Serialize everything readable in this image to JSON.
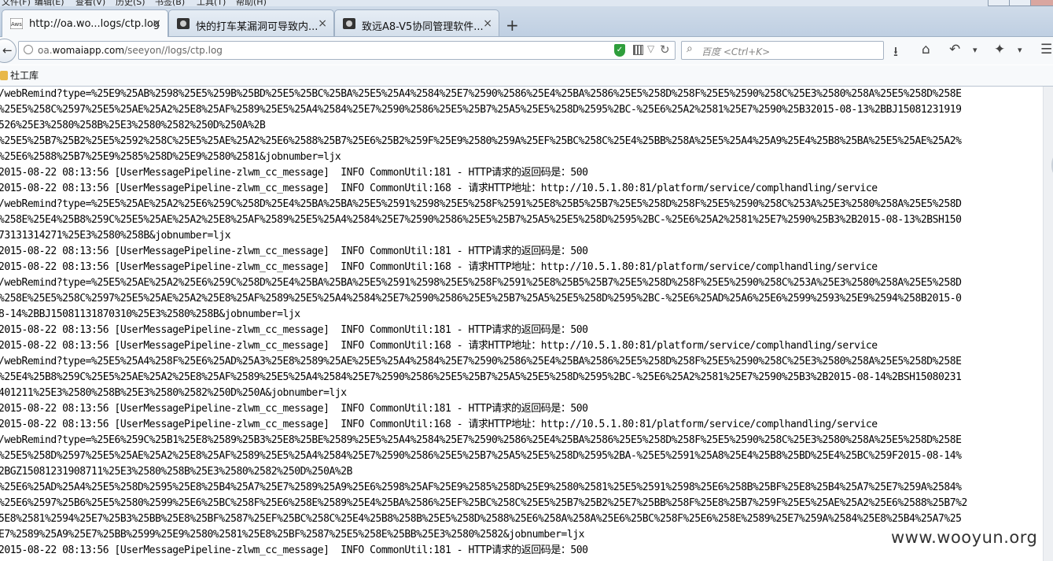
{
  "menu": [
    "文件(F)",
    "编辑(E)",
    "查看(V)",
    "历史(S)",
    "书签(B)",
    "工具(T)",
    "帮助(H)"
  ],
  "tabs": [
    {
      "title": "http://oa.wo...logs/ctp.log",
      "active": true
    },
    {
      "title": "快的打车某漏洞可导致内...",
      "active": false
    },
    {
      "title": "致远A8-V5协同管理软件...",
      "active": false
    }
  ],
  "newtab": "+",
  "close_glyph": "×",
  "urlbar": {
    "prefix": "oa.",
    "domain": "womaiapp.com",
    "path": "/seeyon//logs/ctp.log"
  },
  "search": {
    "placeholder": "百度 <Ctrl+K>"
  },
  "bookmarks": [
    {
      "label": "社工库"
    }
  ],
  "log_lines": [
    "/webRemind?type=%25E9%25AB%2598%25E5%259B%25BD%25E5%25BC%25BA%25E5%25A4%2584%25E7%2590%2586%25E4%25BA%2586%25E5%258D%258F%25E5%2590%258C%25E3%2580%258A%25E5%258D%258E",
    "%25E5%258C%2597%25E5%25AE%25A2%25E8%25AF%2589%25E5%25A4%2584%25E7%2590%2586%25E5%25B7%25A5%25E5%258D%2595%2BC-%25E6%25A2%2581%25E7%2590%25B32015-08-13%2BBJ15081231919",
    "526%25E3%2580%258B%25E3%2580%2582%250D%250A%2B",
    "%25E5%25B7%25B2%25E5%2592%258C%25E5%25AE%25A2%25E6%2588%25B7%25E6%25B2%259F%25E9%2580%259A%25EF%25BC%258C%25E4%25BB%258A%25E5%25A4%25A9%25E4%25B8%25BA%25E5%25AE%25A2%",
    "%25E6%2588%25B7%25E9%2585%258D%25E9%2580%2581&jobnumber=ljx",
    "2015-08-22 08:13:56 [UserMessagePipeline-zlwm_cc_message]  INFO CommonUtil:181 - HTTP请求的返回码是：500",
    "2015-08-22 08:13:56 [UserMessagePipeline-zlwm_cc_message]  INFO CommonUtil:168 - 请求HTTP地址：http://10.5.1.80:81/platform/service/complhandling/service",
    "/webRemind?type=%25E5%25AE%25A2%25E6%259C%258D%25E4%25BA%25BA%25E5%2591%2598%25E5%258F%2591%25E8%25B5%25B7%25E5%258D%258F%25E5%2590%258C%253A%25E3%2580%258A%25E5%258D",
    "%258E%25E4%25B8%259C%25E5%25AE%25A2%25E8%25AF%2589%25E5%25A4%2584%25E7%2590%2586%25E5%25B7%25A5%25E5%258D%2595%2BC-%25E6%25A2%2581%25E7%2590%25B3%2B2015-08-13%2BSH150",
    "73131314271%25E3%2580%258B&jobnumber=ljx",
    "2015-08-22 08:13:56 [UserMessagePipeline-zlwm_cc_message]  INFO CommonUtil:181 - HTTP请求的返回码是：500",
    "2015-08-22 08:13:56 [UserMessagePipeline-zlwm_cc_message]  INFO CommonUtil:168 - 请求HTTP地址：http://10.5.1.80:81/platform/service/complhandling/service",
    "/webRemind?type=%25E5%25AE%25A2%25E6%259C%258D%25E4%25BA%25BA%25E5%2591%2598%25E5%258F%2591%25E8%25B5%25B7%25E5%258D%258F%25E5%2590%258C%253A%25E3%2580%258A%25E5%258D",
    "%258E%25E5%258C%2597%25E5%25AE%25A2%25E8%25AF%2589%25E5%25A4%2584%25E7%2590%2586%25E5%25B7%25A5%25E5%258D%2595%2BC-%25E6%25AD%25A6%25E6%2599%2593%25E9%2594%258B2015-0",
    "8-14%2BBJ15081131870310%25E3%2580%258B&jobnumber=ljx",
    "2015-08-22 08:13:56 [UserMessagePipeline-zlwm_cc_message]  INFO CommonUtil:181 - HTTP请求的返回码是：500",
    "2015-08-22 08:13:56 [UserMessagePipeline-zlwm_cc_message]  INFO CommonUtil:168 - 请求HTTP地址：http://10.5.1.80:81/platform/service/complhandling/service",
    "/webRemind?type=%25E5%25A4%258F%25E6%25AD%25A3%25E8%2589%25AE%25E5%25A4%2584%25E7%2590%2586%25E4%25BA%2586%25E5%258D%258F%25E5%2590%258C%25E3%2580%258A%25E5%258D%258E",
    "%25E4%25B8%259C%25E5%25AE%25A2%25E8%25AF%2589%25E5%25A4%2584%25E7%2590%2586%25E5%25B7%25A5%25E5%258D%2595%2BC-%25E6%25A2%2581%25E7%2590%25B3%2B2015-08-14%2BSH15080231",
    "401211%25E3%2580%258B%25E3%2580%2582%250D%250A&jobnumber=ljx",
    "2015-08-22 08:13:56 [UserMessagePipeline-zlwm_cc_message]  INFO CommonUtil:181 - HTTP请求的返回码是：500",
    "2015-08-22 08:13:56 [UserMessagePipeline-zlwm_cc_message]  INFO CommonUtil:168 - 请求HTTP地址：http://10.5.1.80:81/platform/service/complhandling/service",
    "/webRemind?type=%25E6%259C%25B1%25E8%2589%25B3%25E8%25BE%2589%25E5%25A4%2584%25E7%2590%2586%25E4%25BA%2586%25E5%258D%258F%25E5%2590%258C%25E3%2580%258A%25E5%258D%258E",
    "%25E5%258D%2597%25E5%25AE%25A2%25E8%25AF%2589%25E5%25A4%2584%25E7%2590%2586%25E5%25B7%25A5%25E5%258D%2595%2BA-%25E5%2591%25A8%25E4%25B8%25BD%25E4%25BC%259F2015-08-14%",
    "2BGZ15081231908711%25E3%2580%258B%25E3%2580%2582%250D%250A%2B",
    "%25E6%25AD%25A4%25E5%258D%2595%25E8%25B4%25A7%25E7%2589%25A9%25E6%2598%25AF%25E9%2585%258D%25E9%2580%2581%25E5%2591%2598%25E6%258B%25BF%25E8%25B4%25A7%25E7%259A%2584%",
    "%25E6%2597%25B6%25E5%2580%2599%25E6%25BC%258F%25E6%258E%2589%25E4%25BA%2586%25EF%25BC%258C%25E5%25B7%25B2%25E7%25BB%258F%25E8%25B7%259F%25E5%25AE%25A2%25E6%2588%25B7%2",
    "5E8%2581%2594%25E7%25B3%25BB%25E8%25BF%2587%25EF%25BC%258C%25E4%25B8%258B%25E5%258D%2588%25E6%258A%258A%25E6%25BC%258F%25E6%258E%2589%25E7%259A%2584%25E8%25B4%25A7%25",
    "E7%2589%25A9%25E7%25BB%2599%25E9%2580%2581%25E8%25BF%2587%25E5%258E%25BB%25E3%2580%2582&jobnumber=ljx",
    "2015-08-22 08:13:56 [UserMessagePipeline-zlwm_cc_message]  INFO CommonUtil:181 - HTTP请求的返回码是：500"
  ],
  "watermark": "www.wooyun.org"
}
